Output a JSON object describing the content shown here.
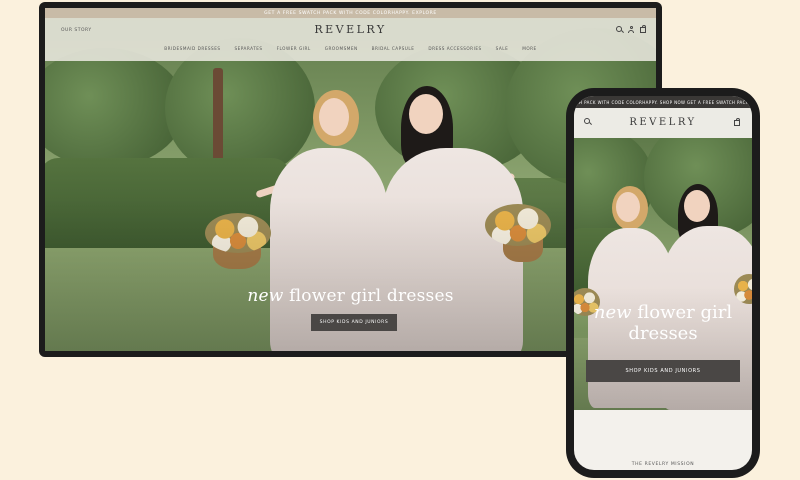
{
  "desktop": {
    "announcement": "GET A FREE SWATCH PACK WITH CODE COLORHAPPY. EXPLORE",
    "left_link": "OUR STORY",
    "logo": "REVELRY",
    "nav": [
      "BRIDESMAID DRESSES",
      "SEPARATES",
      "FLOWER GIRL",
      "GROOMSMEN",
      "BRIDAL CAPSULE",
      "DRESS ACCESSORIES",
      "SALE",
      "MORE"
    ],
    "headline_italic": "new",
    "headline_rest": " flower girl dresses",
    "cta": "SHOP KIDS AND JUNIORS",
    "icons": [
      "search-icon",
      "account-icon",
      "bag-icon"
    ]
  },
  "mobile": {
    "announcement": "SWATCH PACK WITH CODE COLORHAPPY. SHOP NOW   GET A FREE SWATCH PACK WITH",
    "logo": "REVELRY",
    "headline_italic": "new",
    "headline_line1_rest": " flower girl",
    "headline_line2": "dresses",
    "cta": "SHOP KIDS AND JUNIORS",
    "footer_text": "THE REVELRY MISSION",
    "icons": [
      "search-icon",
      "bag-icon"
    ]
  },
  "colors": {
    "background": "#fbf1dd",
    "device_frame": "#1c1c1c",
    "cta_background": "#4a4745",
    "header_background": "#ecebe5"
  }
}
